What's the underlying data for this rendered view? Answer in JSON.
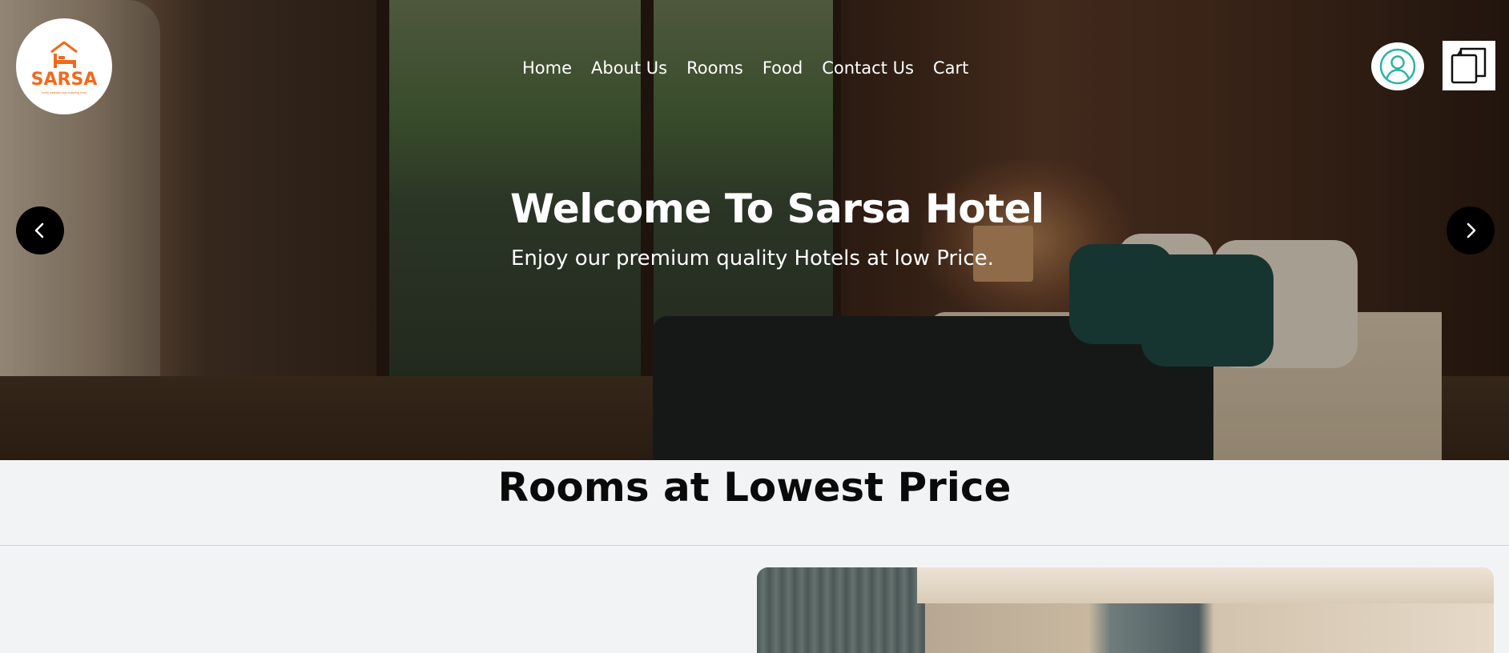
{
  "brand": {
    "name": "SARSA",
    "tagline": "hotel website and ordering food",
    "color": "#f06a1c"
  },
  "nav": {
    "items": [
      {
        "label": "Home"
      },
      {
        "label": "About Us"
      },
      {
        "label": "Rooms"
      },
      {
        "label": "Food"
      },
      {
        "label": "Contact Us"
      },
      {
        "label": "Cart"
      }
    ],
    "user_icon": "user-circle-icon",
    "cart_icon": "clipboard-copy-icon"
  },
  "hero": {
    "title": "Welcome To Sarsa Hotel",
    "subtitle": "Enjoy our premium quality Hotels at low Price.",
    "prev_icon": "chevron-left-icon",
    "next_icon": "chevron-right-icon"
  },
  "rooms_section": {
    "title": "Rooms at Lowest Price"
  },
  "colors": {
    "accent": "#f06a1c",
    "user_icon": "#2bb3a5",
    "background": "#f2f3f5"
  }
}
